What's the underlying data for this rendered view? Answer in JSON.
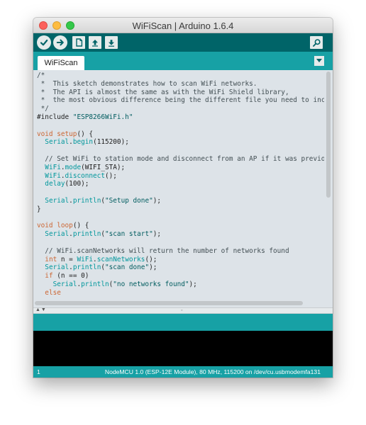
{
  "window": {
    "title": "WiFiScan | Arduino 1.6.4"
  },
  "toolbar": {
    "buttons": [
      {
        "name": "verify",
        "icon": "check-icon"
      },
      {
        "name": "upload",
        "icon": "arrow-right-icon"
      },
      {
        "name": "new",
        "icon": "new-file-icon"
      },
      {
        "name": "open",
        "icon": "arrow-up-icon"
      },
      {
        "name": "save",
        "icon": "arrow-down-icon"
      },
      {
        "name": "serial-monitor",
        "icon": "magnifier-icon"
      }
    ]
  },
  "tabs": [
    {
      "label": "WiFiScan",
      "active": true
    }
  ],
  "tab_menu": {
    "icon": "triangle-down-icon"
  },
  "code_lines": [
    "/*",
    " *  This sketch demonstrates how to scan WiFi networks.",
    " *  The API is almost the same as with the WiFi Shield library,",
    " *  the most obvious difference being the different file you need to include:",
    " */",
    "#include \"ESP8266WiFi.h\"",
    "",
    "void setup() {",
    "  Serial.begin(115200);",
    "",
    "  // Set WiFi to station mode and disconnect from an AP if it was previously connected",
    "  WiFi.mode(WIFI_STA);",
    "  WiFi.disconnect();",
    "  delay(100);",
    "",
    "  Serial.println(\"Setup done\");",
    "}",
    "",
    "void loop() {",
    "  Serial.println(\"scan start\");",
    "",
    "  // WiFi.scanNetworks will return the number of networks found",
    "  int n = WiFi.scanNetworks();",
    "  Serial.println(\"scan done\");",
    "  if (n == 0)",
    "    Serial.println(\"no networks found\");",
    "  else"
  ],
  "status": {
    "line": "1",
    "board": "NodeMCU 1.0 (ESP-12E Module), 80 MHz, 115200 on /dev/cu.usbmodemfa131"
  },
  "colors": {
    "toolbar": "#006468",
    "tabbar": "#17a1a5",
    "editor_bg": "#dde3e8",
    "keyword": "#cc6633",
    "type": "#00979c",
    "string": "#005c5f",
    "comment": "#434f54",
    "console_bg": "#000000"
  }
}
